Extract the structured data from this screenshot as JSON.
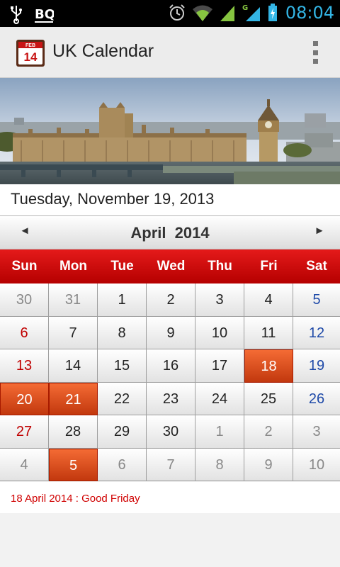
{
  "status_bar": {
    "left_icons": [
      "usb-icon",
      "bq-icon"
    ],
    "right_icons": [
      "alarm-icon",
      "wifi-icon",
      "signal-icon",
      "signal-g-icon",
      "battery-charging-icon"
    ],
    "time": "08:04",
    "bq_text": "BQ",
    "g_text": "G"
  },
  "app_bar": {
    "icon": {
      "month": "FEB",
      "day": "14"
    },
    "title": "UK Calendar",
    "menu_icon": "overflow-menu-icon"
  },
  "banner": {
    "subject": "London skyline with Houses of Parliament and Big Ben"
  },
  "today_label": "Tuesday, November 19, 2013",
  "calendar": {
    "month": "April",
    "year": "2014",
    "prev_symbol": "◄",
    "next_symbol": "►",
    "weekdays": [
      "Sun",
      "Mon",
      "Tue",
      "Wed",
      "Thu",
      "Fri",
      "Sat"
    ],
    "days": [
      {
        "label": "30",
        "type": "other"
      },
      {
        "label": "31",
        "type": "other"
      },
      {
        "label": "1"
      },
      {
        "label": "2"
      },
      {
        "label": "3"
      },
      {
        "label": "4"
      },
      {
        "label": "5",
        "type": "sat"
      },
      {
        "label": "6",
        "type": "sun"
      },
      {
        "label": "7"
      },
      {
        "label": "8"
      },
      {
        "label": "9"
      },
      {
        "label": "10"
      },
      {
        "label": "11"
      },
      {
        "label": "12",
        "type": "sat"
      },
      {
        "label": "13",
        "type": "sun"
      },
      {
        "label": "14"
      },
      {
        "label": "15"
      },
      {
        "label": "16"
      },
      {
        "label": "17"
      },
      {
        "label": "18",
        "type": "hol"
      },
      {
        "label": "19",
        "type": "sat"
      },
      {
        "label": "20",
        "type": "hol"
      },
      {
        "label": "21",
        "type": "hol"
      },
      {
        "label": "22"
      },
      {
        "label": "23"
      },
      {
        "label": "24"
      },
      {
        "label": "25"
      },
      {
        "label": "26",
        "type": "sat"
      },
      {
        "label": "27",
        "type": "sun"
      },
      {
        "label": "28"
      },
      {
        "label": "29"
      },
      {
        "label": "30"
      },
      {
        "label": "1",
        "type": "other"
      },
      {
        "label": "2",
        "type": "other"
      },
      {
        "label": "3",
        "type": "other"
      },
      {
        "label": "4",
        "type": "other"
      },
      {
        "label": "5",
        "type": "hol"
      },
      {
        "label": "6",
        "type": "other"
      },
      {
        "label": "7",
        "type": "other"
      },
      {
        "label": "8",
        "type": "other"
      },
      {
        "label": "9",
        "type": "other"
      },
      {
        "label": "10",
        "type": "other"
      }
    ]
  },
  "holiday_note": "18 April 2014 : Good Friday",
  "colors": {
    "header_red": "#d40d0d",
    "holiday_orange": "#e0541e",
    "sunday_red": "#c00000",
    "saturday_blue": "#1f4aa8",
    "clock_blue": "#33b5e5"
  }
}
